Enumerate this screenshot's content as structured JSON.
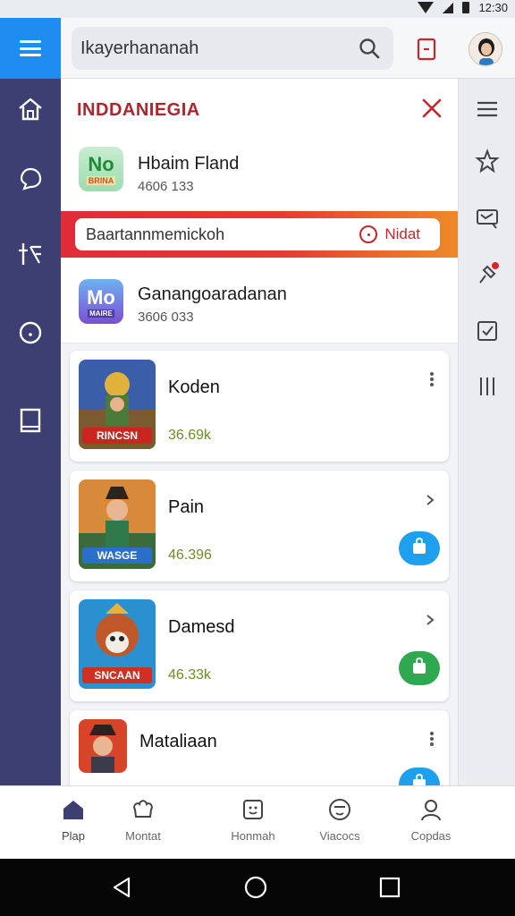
{
  "status": {
    "time": "12:30"
  },
  "search": {
    "query": "Ikayerhananah"
  },
  "sidebar_left": {
    "items": [
      "home-icon",
      "chat-icon",
      "tag-icon",
      "clock-icon",
      "book-icon"
    ]
  },
  "sidebar_right": {
    "items": [
      "menu-icon",
      "star-icon",
      "message-icon",
      "pin-icon",
      "check-icon",
      "columns-icon"
    ]
  },
  "panel": {
    "title": "INDDANIEGIA",
    "top_app": {
      "icon_text": "No",
      "icon_sub": "BRINA",
      "title": "Hbaim Fland",
      "subtitle": "4606 133"
    },
    "banner": {
      "text": "Baartannmemickoh",
      "action": "Nidat"
    },
    "second_app": {
      "icon_text": "Mo",
      "icon_sub": "MAIRE",
      "title": "Ganangoaradanan",
      "subtitle": "3606 033"
    }
  },
  "games": [
    {
      "title": "Koden",
      "count": "36.69k",
      "tag": "RINCSN",
      "control": "menu"
    },
    {
      "title": "Pain",
      "count": "46.396",
      "tag": "WASGE",
      "control": "chevron",
      "button_color": "#1ea0ee"
    },
    {
      "title": "Damesd",
      "count": "46.33k",
      "tag": "SNCAAN",
      "control": "chevron",
      "button_color": "#2fa84f"
    },
    {
      "title": "Mataliaan",
      "count": "",
      "tag": "",
      "control": "menu",
      "button_color": "#1ea0ee"
    }
  ],
  "bottom_nav": [
    {
      "label": "Plap",
      "icon": "home-icon",
      "active": true
    },
    {
      "label": "Montat",
      "icon": "gift-icon"
    },
    {
      "label": "Honmah",
      "icon": "smile-box-icon"
    },
    {
      "label": "Viacocs",
      "icon": "face-icon"
    },
    {
      "label": "Copdas",
      "icon": "person-icon"
    }
  ],
  "colors": {
    "accent": "#1e8cf0",
    "rail": "#3d3f72",
    "title_red": "#b0242c",
    "banner_red": "#e02c38"
  }
}
